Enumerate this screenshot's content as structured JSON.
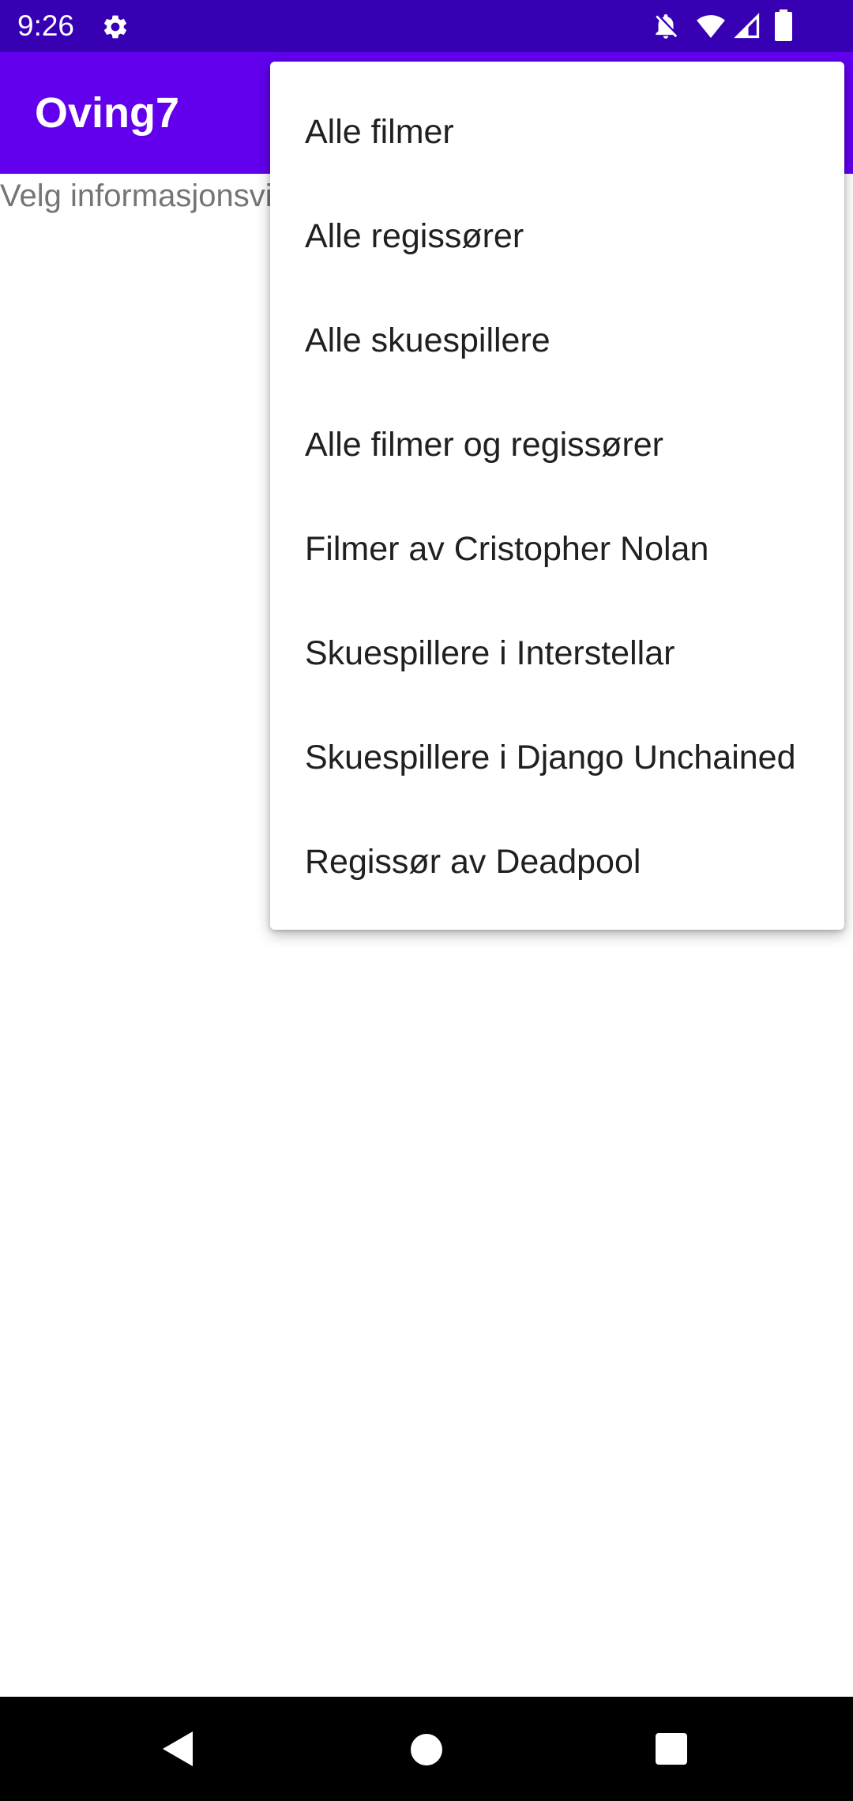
{
  "status_bar": {
    "time": "9:26",
    "icons": [
      "settings-gear-icon",
      "notifications-off-icon",
      "wifi-icon",
      "cell-signal-icon",
      "battery-icon"
    ],
    "background": "#3700B3"
  },
  "app_bar": {
    "title": "Oving7",
    "background": "#6200EE"
  },
  "content": {
    "text": "Velg informasjonsvi"
  },
  "menu": {
    "items": [
      {
        "label": "Alle filmer"
      },
      {
        "label": "Alle regissører"
      },
      {
        "label": "Alle skuespillere"
      },
      {
        "label": "Alle filmer og regissører"
      },
      {
        "label": "Filmer av Cristopher Nolan"
      },
      {
        "label": "Skuespillere i Interstellar"
      },
      {
        "label": "Skuespillere i Django Unchained"
      },
      {
        "label": "Regissør av Deadpool"
      }
    ]
  },
  "nav_bar": {
    "icons": [
      "back-icon",
      "home-icon",
      "recents-icon"
    ],
    "background": "#000000"
  }
}
